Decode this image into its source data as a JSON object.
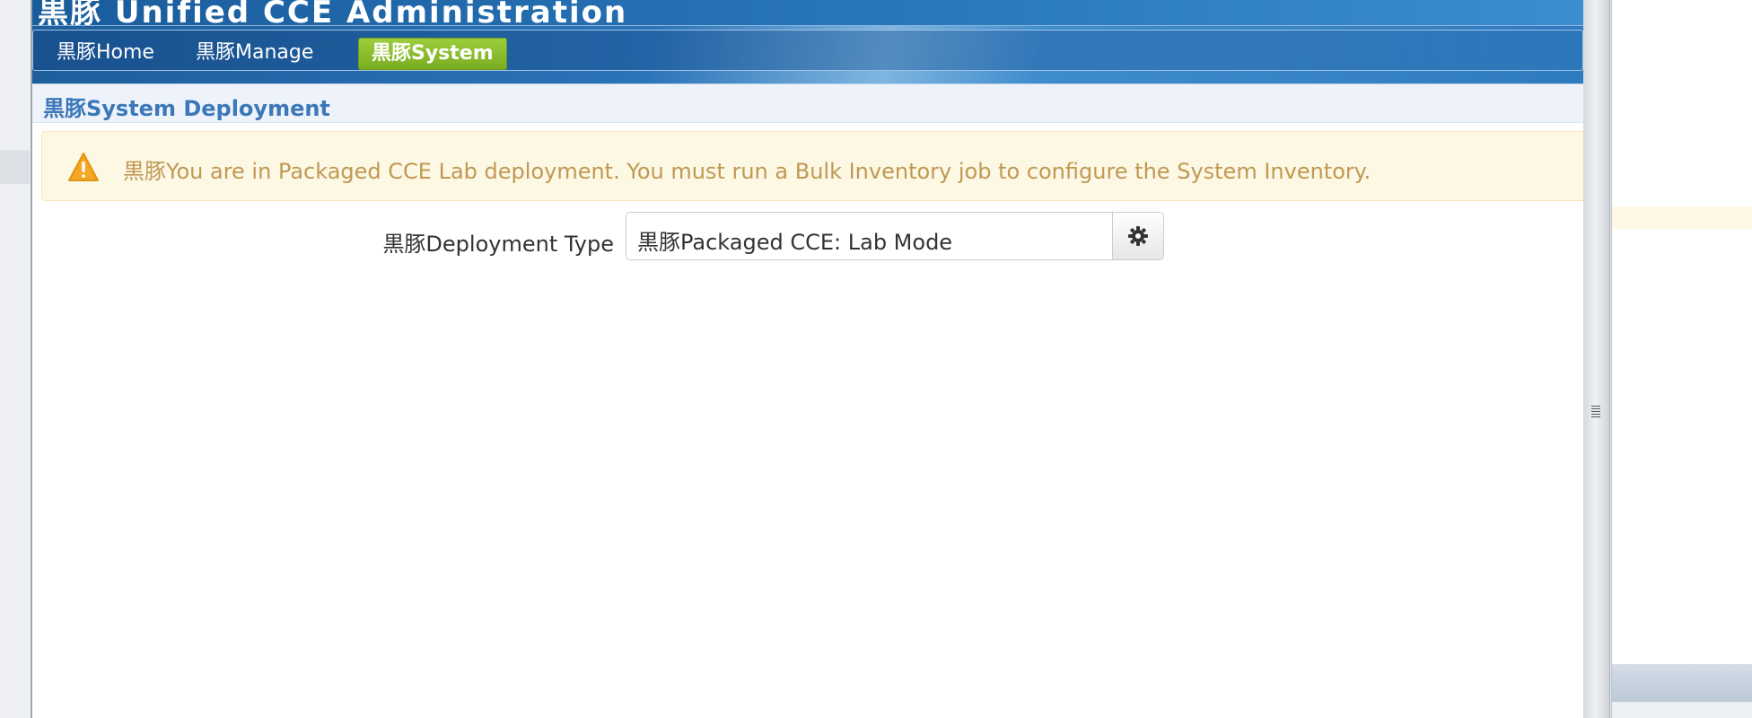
{
  "window": {
    "title": "黒豚 Unified CCE Administration"
  },
  "nav": {
    "items": [
      {
        "label": "黒豚Home",
        "active": false
      },
      {
        "label": "黒豚Manage",
        "active": false
      },
      {
        "label": "黒豚System",
        "active": true
      }
    ]
  },
  "section": {
    "title": "黒豚System Deployment"
  },
  "alert": {
    "icon": "warning-icon",
    "message": "黒豚You are in Packaged CCE Lab deployment. You must run a Bulk Inventory job to configure the System Inventory."
  },
  "form": {
    "deployment_type_label": "黒豚Deployment Type",
    "deployment_type_value": "黒豚Packaged CCE: Lab Mode",
    "edit_icon": "gear-icon"
  },
  "colors": {
    "nav_active": "#8cbf2f",
    "alert_text": "#c09853",
    "header_text": "#3c78b8",
    "alert_bg": "#fcf8e3"
  }
}
